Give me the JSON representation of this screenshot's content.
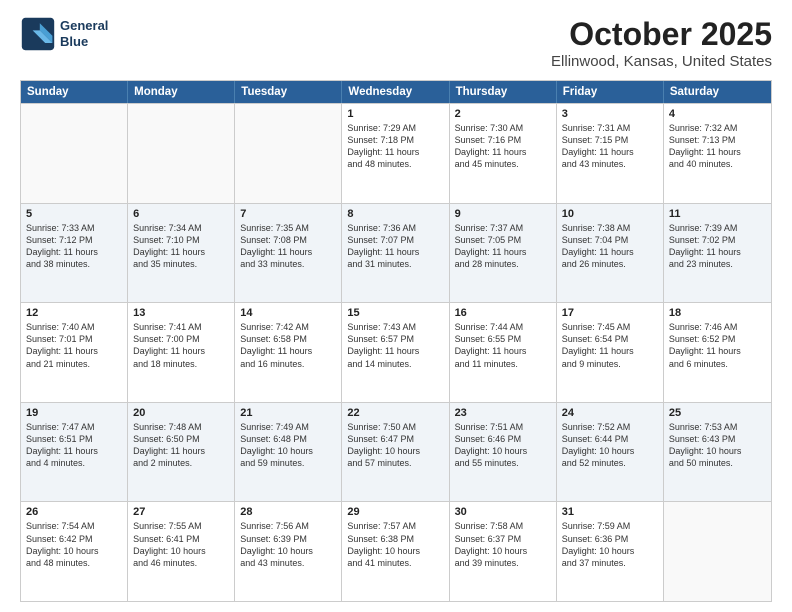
{
  "header": {
    "logo_line1": "General",
    "logo_line2": "Blue",
    "title": "October 2025",
    "subtitle": "Ellinwood, Kansas, United States"
  },
  "weekdays": [
    "Sunday",
    "Monday",
    "Tuesday",
    "Wednesday",
    "Thursday",
    "Friday",
    "Saturday"
  ],
  "rows": [
    [
      {
        "day": "",
        "info": "",
        "empty": true
      },
      {
        "day": "",
        "info": "",
        "empty": true
      },
      {
        "day": "",
        "info": "",
        "empty": true
      },
      {
        "day": "1",
        "info": "Sunrise: 7:29 AM\nSunset: 7:18 PM\nDaylight: 11 hours\nand 48 minutes."
      },
      {
        "day": "2",
        "info": "Sunrise: 7:30 AM\nSunset: 7:16 PM\nDaylight: 11 hours\nand 45 minutes."
      },
      {
        "day": "3",
        "info": "Sunrise: 7:31 AM\nSunset: 7:15 PM\nDaylight: 11 hours\nand 43 minutes."
      },
      {
        "day": "4",
        "info": "Sunrise: 7:32 AM\nSunset: 7:13 PM\nDaylight: 11 hours\nand 40 minutes."
      }
    ],
    [
      {
        "day": "5",
        "info": "Sunrise: 7:33 AM\nSunset: 7:12 PM\nDaylight: 11 hours\nand 38 minutes."
      },
      {
        "day": "6",
        "info": "Sunrise: 7:34 AM\nSunset: 7:10 PM\nDaylight: 11 hours\nand 35 minutes."
      },
      {
        "day": "7",
        "info": "Sunrise: 7:35 AM\nSunset: 7:08 PM\nDaylight: 11 hours\nand 33 minutes."
      },
      {
        "day": "8",
        "info": "Sunrise: 7:36 AM\nSunset: 7:07 PM\nDaylight: 11 hours\nand 31 minutes."
      },
      {
        "day": "9",
        "info": "Sunrise: 7:37 AM\nSunset: 7:05 PM\nDaylight: 11 hours\nand 28 minutes."
      },
      {
        "day": "10",
        "info": "Sunrise: 7:38 AM\nSunset: 7:04 PM\nDaylight: 11 hours\nand 26 minutes."
      },
      {
        "day": "11",
        "info": "Sunrise: 7:39 AM\nSunset: 7:02 PM\nDaylight: 11 hours\nand 23 minutes."
      }
    ],
    [
      {
        "day": "12",
        "info": "Sunrise: 7:40 AM\nSunset: 7:01 PM\nDaylight: 11 hours\nand 21 minutes."
      },
      {
        "day": "13",
        "info": "Sunrise: 7:41 AM\nSunset: 7:00 PM\nDaylight: 11 hours\nand 18 minutes."
      },
      {
        "day": "14",
        "info": "Sunrise: 7:42 AM\nSunset: 6:58 PM\nDaylight: 11 hours\nand 16 minutes."
      },
      {
        "day": "15",
        "info": "Sunrise: 7:43 AM\nSunset: 6:57 PM\nDaylight: 11 hours\nand 14 minutes."
      },
      {
        "day": "16",
        "info": "Sunrise: 7:44 AM\nSunset: 6:55 PM\nDaylight: 11 hours\nand 11 minutes."
      },
      {
        "day": "17",
        "info": "Sunrise: 7:45 AM\nSunset: 6:54 PM\nDaylight: 11 hours\nand 9 minutes."
      },
      {
        "day": "18",
        "info": "Sunrise: 7:46 AM\nSunset: 6:52 PM\nDaylight: 11 hours\nand 6 minutes."
      }
    ],
    [
      {
        "day": "19",
        "info": "Sunrise: 7:47 AM\nSunset: 6:51 PM\nDaylight: 11 hours\nand 4 minutes."
      },
      {
        "day": "20",
        "info": "Sunrise: 7:48 AM\nSunset: 6:50 PM\nDaylight: 11 hours\nand 2 minutes."
      },
      {
        "day": "21",
        "info": "Sunrise: 7:49 AM\nSunset: 6:48 PM\nDaylight: 10 hours\nand 59 minutes."
      },
      {
        "day": "22",
        "info": "Sunrise: 7:50 AM\nSunset: 6:47 PM\nDaylight: 10 hours\nand 57 minutes."
      },
      {
        "day": "23",
        "info": "Sunrise: 7:51 AM\nSunset: 6:46 PM\nDaylight: 10 hours\nand 55 minutes."
      },
      {
        "day": "24",
        "info": "Sunrise: 7:52 AM\nSunset: 6:44 PM\nDaylight: 10 hours\nand 52 minutes."
      },
      {
        "day": "25",
        "info": "Sunrise: 7:53 AM\nSunset: 6:43 PM\nDaylight: 10 hours\nand 50 minutes."
      }
    ],
    [
      {
        "day": "26",
        "info": "Sunrise: 7:54 AM\nSunset: 6:42 PM\nDaylight: 10 hours\nand 48 minutes."
      },
      {
        "day": "27",
        "info": "Sunrise: 7:55 AM\nSunset: 6:41 PM\nDaylight: 10 hours\nand 46 minutes."
      },
      {
        "day": "28",
        "info": "Sunrise: 7:56 AM\nSunset: 6:39 PM\nDaylight: 10 hours\nand 43 minutes."
      },
      {
        "day": "29",
        "info": "Sunrise: 7:57 AM\nSunset: 6:38 PM\nDaylight: 10 hours\nand 41 minutes."
      },
      {
        "day": "30",
        "info": "Sunrise: 7:58 AM\nSunset: 6:37 PM\nDaylight: 10 hours\nand 39 minutes."
      },
      {
        "day": "31",
        "info": "Sunrise: 7:59 AM\nSunset: 6:36 PM\nDaylight: 10 hours\nand 37 minutes."
      },
      {
        "day": "",
        "info": "",
        "empty": true
      }
    ]
  ]
}
